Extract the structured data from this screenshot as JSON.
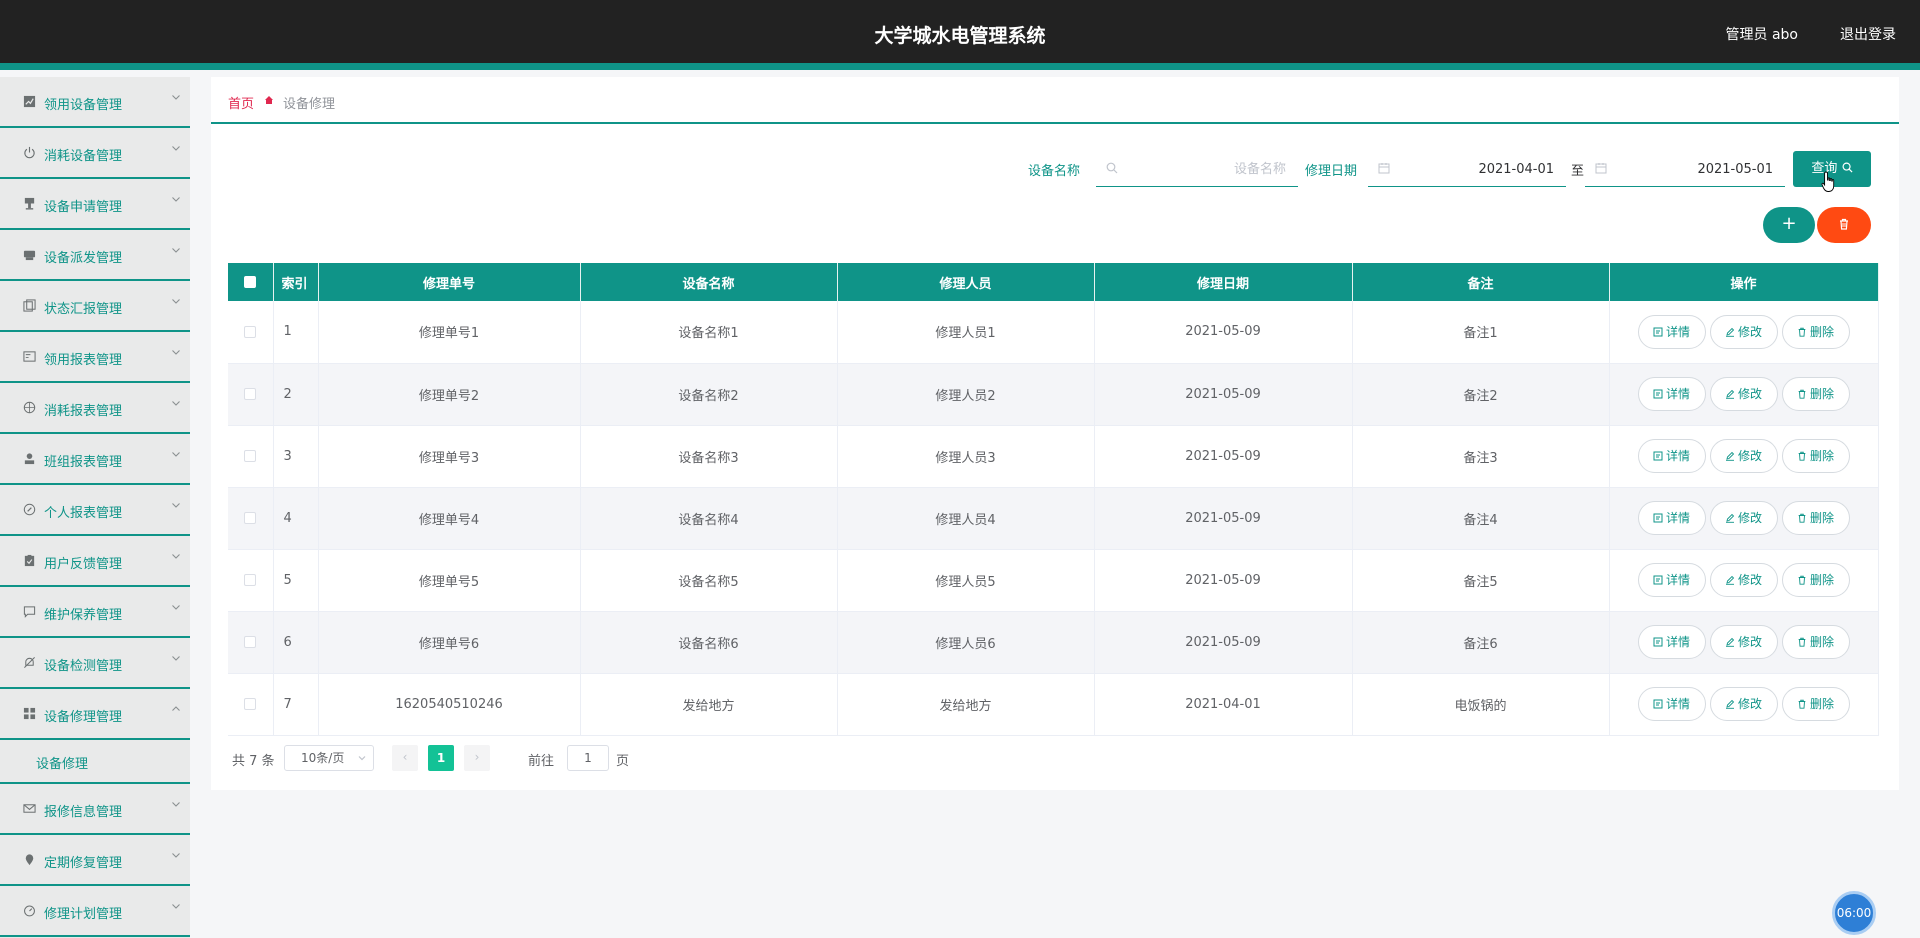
{
  "header": {
    "title": "大学城水电管理系统",
    "user": "管理员 abo",
    "logout": "退出登录"
  },
  "sidebar": {
    "items": [
      {
        "label": "领用设备管理",
        "icon": "chart-icon"
      },
      {
        "label": "消耗设备管理",
        "icon": "power-icon"
      },
      {
        "label": "设备申请管理",
        "icon": "stamp-icon"
      },
      {
        "label": "设备派发管理",
        "icon": "printer-icon"
      },
      {
        "label": "状态汇报管理",
        "icon": "copy-icon"
      },
      {
        "label": "领用报表管理",
        "icon": "postcard-icon"
      },
      {
        "label": "消耗报表管理",
        "icon": "basketball-icon"
      },
      {
        "label": "班组报表管理",
        "icon": "user-icon"
      },
      {
        "label": "个人报表管理",
        "icon": "compass-icon"
      },
      {
        "label": "用户反馈管理",
        "icon": "clipboard-icon"
      },
      {
        "label": "维护保养管理",
        "icon": "chat-icon"
      },
      {
        "label": "设备检测管理",
        "icon": "bell-off-icon"
      },
      {
        "label": "设备修理管理",
        "icon": "grid-icon",
        "expanded": true,
        "children": [
          "设备修理"
        ]
      },
      {
        "label": "报修信息管理",
        "icon": "mail-icon"
      },
      {
        "label": "定期修复管理",
        "icon": "location-icon"
      },
      {
        "label": "修理计划管理",
        "icon": "timer-icon"
      }
    ]
  },
  "breadcrumb": {
    "home": "首页",
    "current": "设备修理"
  },
  "search": {
    "name_label": "设备名称",
    "name_placeholder": "设备名称",
    "date_label": "修理日期",
    "date_start": "2021-04-01",
    "range_sep": "至",
    "date_end": "2021-05-01",
    "query_label": "查询"
  },
  "table": {
    "headers": [
      "索引",
      "修理单号",
      "设备名称",
      "修理人员",
      "修理日期",
      "备注",
      "操作"
    ],
    "rows": [
      {
        "idx": "1",
        "no": "修理单号1",
        "name": "设备名称1",
        "person": "修理人员1",
        "date": "2021-05-09",
        "note": "备注1"
      },
      {
        "idx": "2",
        "no": "修理单号2",
        "name": "设备名称2",
        "person": "修理人员2",
        "date": "2021-05-09",
        "note": "备注2"
      },
      {
        "idx": "3",
        "no": "修理单号3",
        "name": "设备名称3",
        "person": "修理人员3",
        "date": "2021-05-09",
        "note": "备注3"
      },
      {
        "idx": "4",
        "no": "修理单号4",
        "name": "设备名称4",
        "person": "修理人员4",
        "date": "2021-05-09",
        "note": "备注4"
      },
      {
        "idx": "5",
        "no": "修理单号5",
        "name": "设备名称5",
        "person": "修理人员5",
        "date": "2021-05-09",
        "note": "备注5"
      },
      {
        "idx": "6",
        "no": "修理单号6",
        "name": "设备名称6",
        "person": "修理人员6",
        "date": "2021-05-09",
        "note": "备注6"
      },
      {
        "idx": "7",
        "no": "1620540510246",
        "name": "发给地方",
        "person": "发给地方",
        "date": "2021-04-01",
        "note": "电饭锅的"
      }
    ],
    "actions": {
      "detail": "详情",
      "edit": "修改",
      "delete": "删除"
    }
  },
  "pagination": {
    "total": "共 7 条",
    "page_size": "10条/页",
    "current_page": "1",
    "goto_label": "前往",
    "goto_value": "1",
    "page_unit": "页"
  },
  "clock": "06:00",
  "colors": {
    "accent": "#0f9488",
    "danger": "#ff4a12",
    "header_bg": "#222222",
    "active_page": "#13c296"
  }
}
